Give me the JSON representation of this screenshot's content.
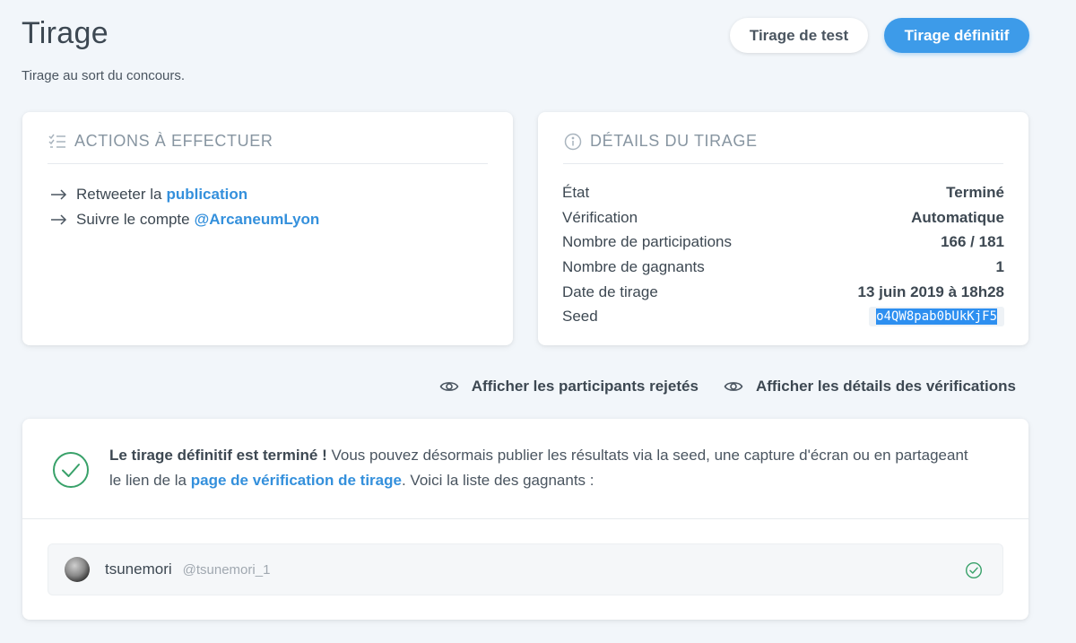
{
  "header": {
    "title": "Tirage",
    "subtitle": "Tirage au sort du concours.",
    "test_button": "Tirage de test",
    "final_button": "Tirage définitif"
  },
  "actions_card": {
    "title": "ACTIONS À EFFECTUER",
    "icon": "checklist-icon",
    "items": [
      {
        "text": "Retweeter la",
        "link": "publication"
      },
      {
        "text": "Suivre le compte",
        "link": "@ArcaneumLyon"
      }
    ]
  },
  "details_card": {
    "title": "DÉTAILS DU TIRAGE",
    "icon": "info-icon",
    "rows": [
      {
        "label": "État",
        "value": "Terminé"
      },
      {
        "label": "Vérification",
        "value": "Automatique"
      },
      {
        "label": "Nombre de participations",
        "value": "166 / 181"
      },
      {
        "label": "Nombre de gagnants",
        "value": "1"
      },
      {
        "label": "Date de tirage",
        "value": "13 juin 2019 à 18h28"
      }
    ],
    "seed_label": "Seed",
    "seed_value": "o4QW8pab0bUkKjF5"
  },
  "links": {
    "rejected": "Afficher les participants rejetés",
    "verifications": "Afficher les détails des vérifications"
  },
  "result": {
    "strong": "Le tirage définitif est terminé !",
    "text_before_link": " Vous pouvez désormais publier les résultats via la seed, une capture d'écran ou en partageant le lien de la ",
    "link": "page de vérification de tirage",
    "text_after_link": ". Voici la liste des gagnants :",
    "winners": [
      {
        "name": "tsunemori",
        "handle": "@tsunemori_1"
      }
    ]
  },
  "colors": {
    "accent": "#3d9be9",
    "link": "#3490dc",
    "success": "#38a169",
    "background": "#f2f6fa"
  }
}
